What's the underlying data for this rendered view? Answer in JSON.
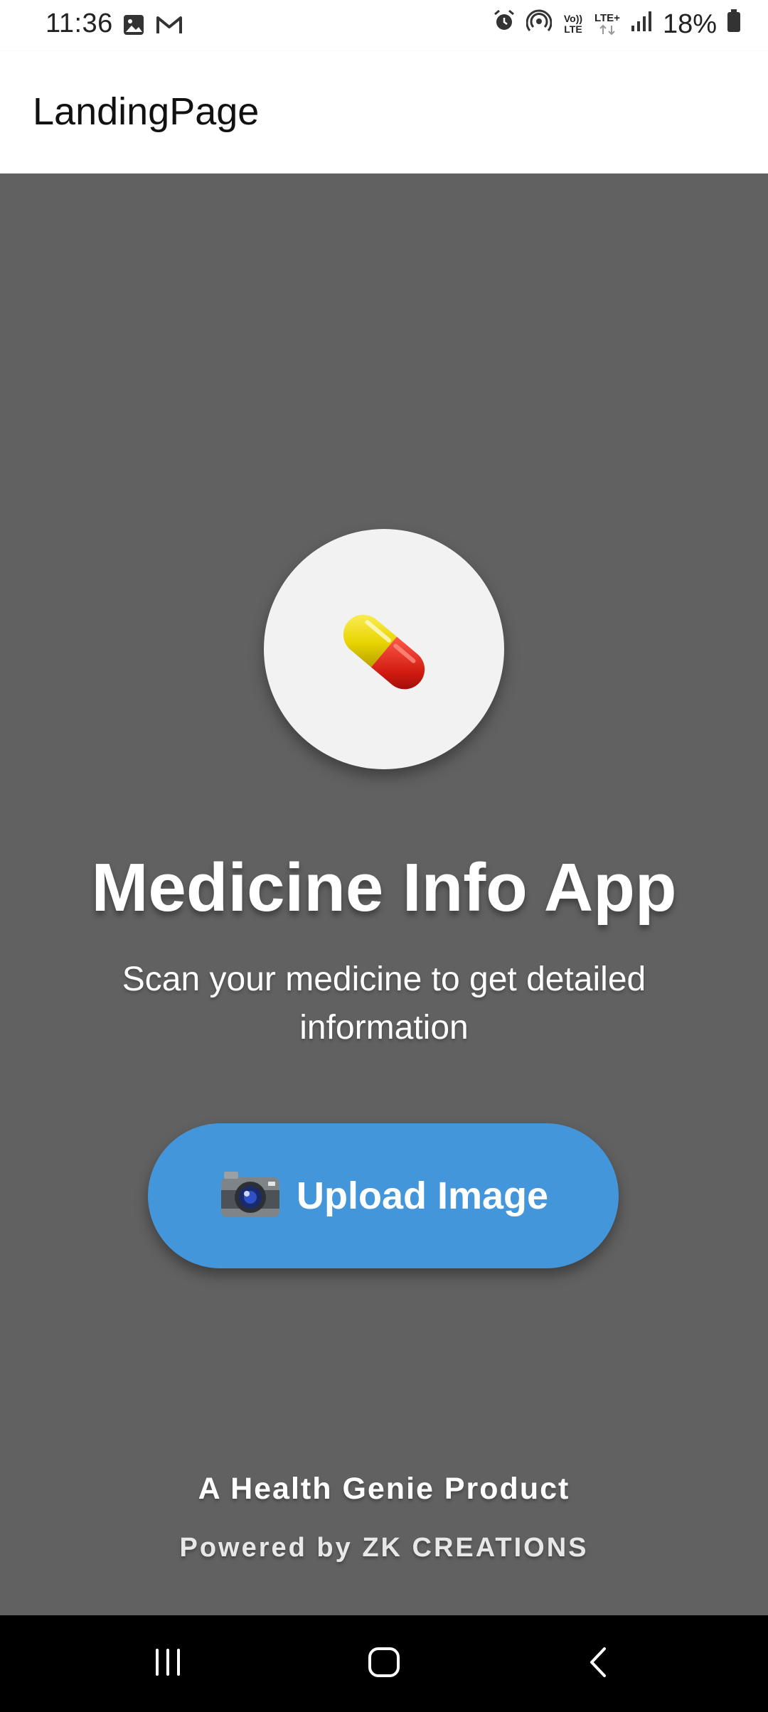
{
  "status_bar": {
    "time": "11:36",
    "network_volte": "Vo)) LTE",
    "network_lte": "LTE+",
    "battery": "18%"
  },
  "app_bar": {
    "title": "LandingPage"
  },
  "main": {
    "logo_icon": "pill-icon",
    "title": "Medicine Info App",
    "subtitle": "Scan your medicine to get detailed information",
    "upload_button": {
      "icon": "camera-icon",
      "label": "Upload Image"
    },
    "footer_line1": "A Health Genie Product",
    "footer_line2": "Powered by ZK CREATIONS"
  },
  "nav_bar": {
    "items": [
      "recents-icon",
      "home-icon",
      "back-icon"
    ]
  },
  "colors": {
    "background": "#616161",
    "button": "#4496da",
    "logo_bg": "#f2f2f2"
  }
}
